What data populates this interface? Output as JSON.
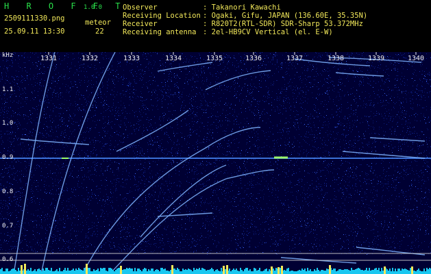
{
  "header": {
    "app_title": "H R O F F T",
    "version": "1.0.0",
    "filename": "2509111330.png",
    "datetime": "25.09.11 13:30",
    "meteor_label": "meteor",
    "meteor_count": "22",
    "info_labels": [
      "Observer",
      "Receiving Location",
      "Receiver",
      "Receiving antenna"
    ],
    "info_values": [
      ": Takanori Kawachi",
      ": Ogaki, Gifu, JAPAN (136.60E, 35.35N)",
      ": R820T2(RTL-SDR) SDR-Sharp 53.372MHz",
      ": 2el-HB9CV Vertical (el. E-W)"
    ]
  },
  "spectrogram": {
    "y_unit": "kHz",
    "y_ticks": [
      "1.1",
      "1.0",
      "0.9",
      "0.8",
      "0.7",
      "0.6"
    ],
    "x_ticks": [
      "1331",
      "1332",
      "1333",
      "1334",
      "1335",
      "1336",
      "1337",
      "1338",
      "1339",
      "1340"
    ],
    "colors": {
      "background": "#000033",
      "noise": "#1530b0",
      "signal": "#7fb4ff",
      "marker": "#f2e85a",
      "level_bar": "#19c7f0"
    }
  }
}
